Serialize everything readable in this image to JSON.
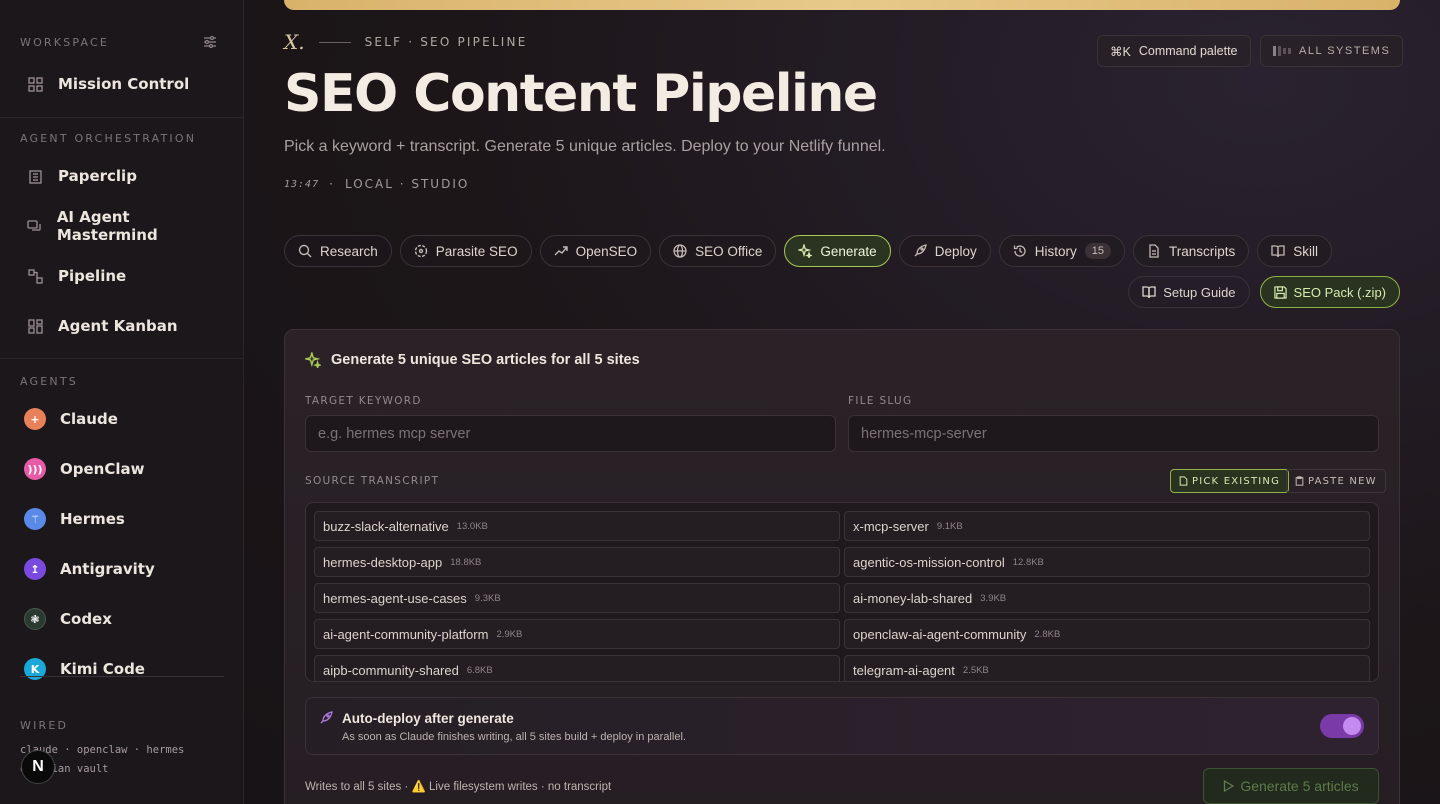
{
  "sidebar": {
    "workspace_label": "WORKSPACE",
    "orchestration_label": "AGENT ORCHESTRATION",
    "agents_label": "AGENTS",
    "wired_label": "WIRED",
    "workspace_items": [
      {
        "label": "Mission Control",
        "icon": "grid-icon"
      }
    ],
    "orchestration_items": [
      {
        "label": "Paperclip",
        "icon": "building-icon"
      },
      {
        "label": "AI Agent Mastermind",
        "icon": "chat-icon"
      },
      {
        "label": "Pipeline",
        "icon": "pipeline-icon"
      },
      {
        "label": "Agent Kanban",
        "icon": "kanban-icon"
      }
    ],
    "agents": [
      {
        "label": "Claude",
        "color": "#e8805a",
        "glyph": "+"
      },
      {
        "label": "OpenClaw",
        "color": "#e85aa8",
        "glyph": ")))"
      },
      {
        "label": "Hermes",
        "color": "#5a8ae8",
        "glyph": "⚚"
      },
      {
        "label": "Antigravity",
        "color": "#7a4ae0",
        "glyph": "↥"
      },
      {
        "label": "Codex",
        "color": "#2a3a30",
        "glyph": "❃"
      },
      {
        "label": "Kimi Code",
        "color": "#1aa8d8",
        "glyph": "K"
      }
    ],
    "wired_line1": "claude · openclaw · hermes",
    "wired_line2": "obsidian vault",
    "avatar_letter": "N"
  },
  "header": {
    "eyebrow_mark": "X.",
    "eyebrow": "SELF · SEO PIPELINE",
    "title": "SEO Content Pipeline",
    "subtitle": "Pick a keyword + transcript. Generate 5 unique articles. Deploy to your Netlify funnel.",
    "time": "13:47",
    "location": "LOCAL · STUDIO",
    "command_palette": "Command palette",
    "shortcut": "⌘K",
    "all_systems": "ALL SYSTEMS"
  },
  "tabs": [
    {
      "label": "Research",
      "icon": "search-icon"
    },
    {
      "label": "Parasite SEO",
      "icon": "target-icon"
    },
    {
      "label": "OpenSEO",
      "icon": "trend-icon"
    },
    {
      "label": "SEO Office",
      "icon": "globe-icon"
    },
    {
      "label": "Generate",
      "icon": "sparkle-icon",
      "active": true
    },
    {
      "label": "Deploy",
      "icon": "rocket-icon"
    },
    {
      "label": "History",
      "icon": "history-icon",
      "badge": "15"
    },
    {
      "label": "Transcripts",
      "icon": "document-icon"
    },
    {
      "label": "Skill",
      "icon": "book-icon"
    }
  ],
  "actions": {
    "setup_guide": "Setup Guide",
    "seo_pack": "SEO Pack (.zip)"
  },
  "panel": {
    "heading": "Generate 5 unique SEO articles for all 5 sites",
    "keyword_label": "TARGET KEYWORD",
    "keyword_placeholder": "e.g. hermes mcp server",
    "keyword_value": "",
    "slug_label": "FILE SLUG",
    "slug_placeholder": "hermes-mcp-server",
    "slug_value": "",
    "transcript_label": "SOURCE TRANSCRIPT",
    "pick_existing": "PICK EXISTING",
    "paste_new": "PASTE NEW",
    "transcripts": [
      {
        "name": "buzz-slack-alternative",
        "size": "13.0KB"
      },
      {
        "name": "x-mcp-server",
        "size": "9.1KB"
      },
      {
        "name": "hermes-desktop-app",
        "size": "18.8KB"
      },
      {
        "name": "agentic-os-mission-control",
        "size": "12.8KB"
      },
      {
        "name": "hermes-agent-use-cases",
        "size": "9.3KB"
      },
      {
        "name": "ai-money-lab-shared",
        "size": "3.9KB"
      },
      {
        "name": "ai-agent-community-platform",
        "size": "2.9KB"
      },
      {
        "name": "openclaw-ai-agent-community",
        "size": "2.8KB"
      },
      {
        "name": "aipb-community-shared",
        "size": "6.8KB"
      },
      {
        "name": "telegram-ai-agent",
        "size": "2.5KB"
      }
    ],
    "auto_deploy_title": "Auto-deploy after generate",
    "auto_deploy_desc": "As soon as Claude finishes writing, all 5 sites build + deploy in parallel.",
    "auto_deploy_on": true,
    "footer_note": "Writes to all 5 sites · ⚠️ Live filesystem writes · no transcript",
    "generate_button": "Generate 5 articles"
  },
  "colors": {
    "accent_green": "#a7c756",
    "accent_gold": "#d9b26a",
    "toggle_purple": "#7a3aa8"
  }
}
